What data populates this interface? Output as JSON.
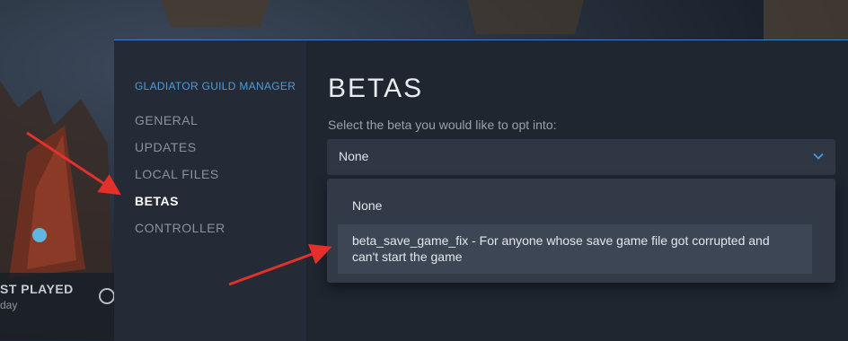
{
  "background": {
    "last_played_label": "ST PLAYED",
    "last_played_value": "day"
  },
  "dialog": {
    "sidebar": {
      "game_title": "GLADIATOR GUILD MANAGER",
      "items": [
        {
          "label": "GENERAL",
          "active": false
        },
        {
          "label": "UPDATES",
          "active": false
        },
        {
          "label": "LOCAL FILES",
          "active": false
        },
        {
          "label": "BETAS",
          "active": true
        },
        {
          "label": "CONTROLLER",
          "active": false
        }
      ]
    },
    "content": {
      "heading": "BETAS",
      "prompt": "Select the beta you would like to opt into:",
      "select": {
        "value": "None",
        "icon": "chevron-down-icon",
        "options": [
          {
            "label": "None"
          },
          {
            "label": "beta_save_game_fix - For anyone whose save game file got corrupted and can't start the game",
            "highlighted": true
          }
        ]
      }
    }
  },
  "colors": {
    "accent": "#4d9bd8",
    "annotation": "#e3302b",
    "sidebar_bg": "#242b37",
    "content_bg": "#1f2630"
  }
}
